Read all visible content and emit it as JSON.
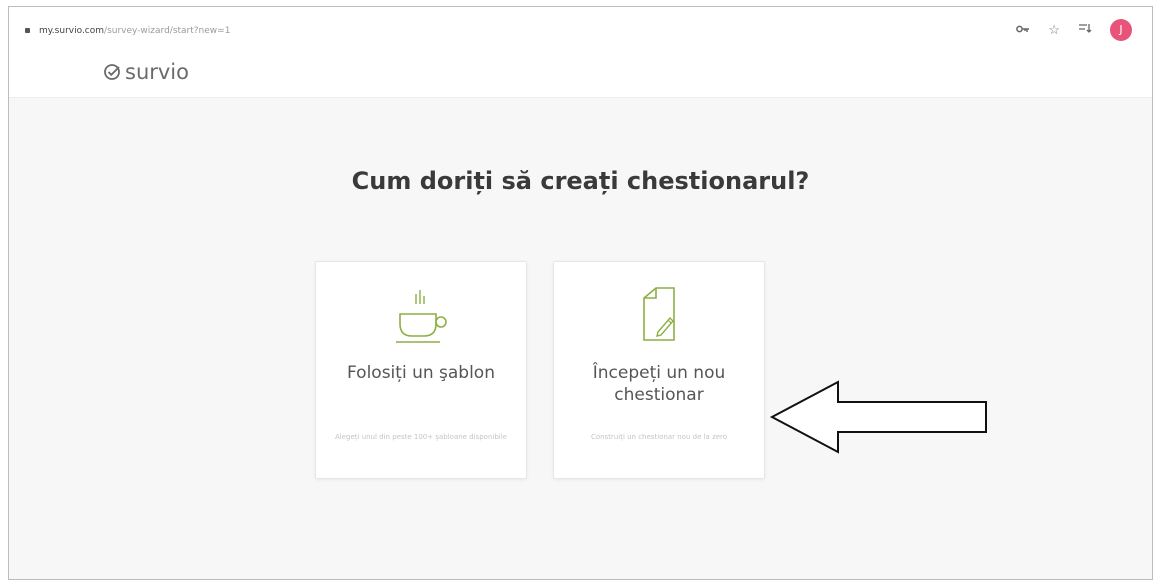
{
  "browser": {
    "url_host": "my.survio.com",
    "url_path": "/survey-wizard/start?new=1",
    "icons": [
      "key-icon",
      "star-icon",
      "queue-icon"
    ],
    "profile_initial": "J"
  },
  "brand": {
    "name": "survio",
    "accent": "#8cb043"
  },
  "main": {
    "heading": "Cum doriți să creați chestionarul?",
    "options": [
      {
        "icon": "coffee-cup-icon",
        "title": "Folosiți un şablon",
        "description": "Alegeți unul din peste 100+ şabloane disponibile"
      },
      {
        "icon": "document-pen-icon",
        "title": "Începeți un nou chestionar",
        "description": "Construiți un chestionar nou de la zero"
      }
    ]
  }
}
